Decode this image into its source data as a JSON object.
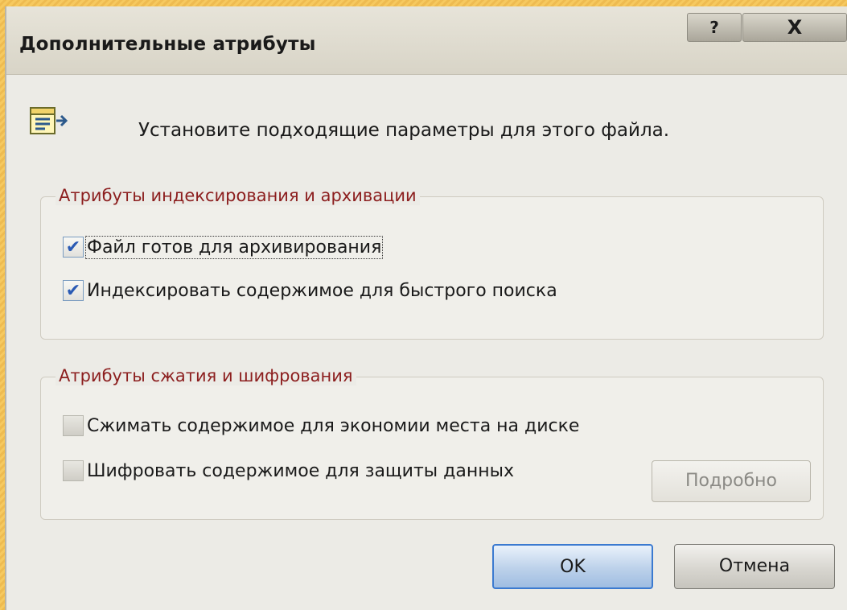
{
  "window": {
    "title": "Дополнительные атрибуты",
    "help_label": "?",
    "close_label": "X"
  },
  "header": {
    "text": "Установите подходящие параметры для этого файла."
  },
  "groups": [
    {
      "legend": "Атрибуты индексирования и архивации",
      "items": [
        {
          "label": "Файл готов для архивирования",
          "checked": true
        },
        {
          "label": "Индексировать содержимое для быстрого поиска",
          "checked": true
        }
      ]
    },
    {
      "legend": "Атрибуты сжатия и шифрования",
      "items": [
        {
          "label": "Сжимать содержимое для экономии места на диске",
          "checked": false
        },
        {
          "label": "Шифровать содержимое для защиты данных",
          "checked": false
        }
      ]
    }
  ],
  "buttons": {
    "details": "Подробно",
    "ok": "OK",
    "cancel": "Отмена"
  },
  "icons": {
    "check_glyph": "✔"
  }
}
